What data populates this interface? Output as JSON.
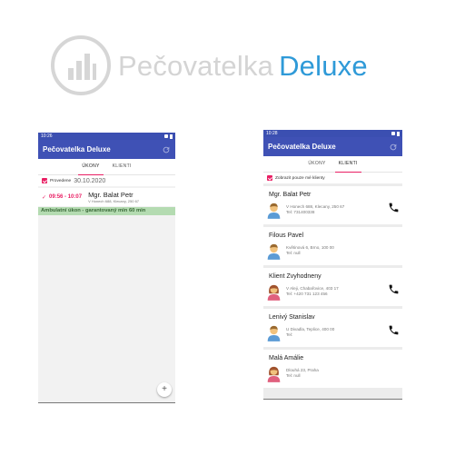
{
  "hero": {
    "brand": "Pečovatelka",
    "edition": "Deluxe",
    "colors": {
      "brand": "#d4d4d4",
      "edition": "#2f9ad8"
    }
  },
  "left_phone": {
    "status_time": "10:26",
    "app_title": "Pečovatelka Deluxe",
    "tabs": [
      "ÚKONY",
      "KLIENTI"
    ],
    "active_tab": "ÚKONY",
    "filter": {
      "label": "Provedene",
      "date": "30.10.2020",
      "checked": true
    },
    "visits": [
      {
        "time": "09:56 - 10:07",
        "client": "Mgr. Balat Petr",
        "address": "V Honech 688, Klecany, 250 67",
        "service": "Ambulatní úkon - garantovaný min 60 min"
      }
    ],
    "fab_label": "+"
  },
  "right_phone": {
    "status_time": "10:28",
    "app_title": "Pečovatelka Deluxe",
    "tabs": [
      "ÚKONY",
      "KLIENTI"
    ],
    "active_tab": "KLIENTI",
    "filter": {
      "label": "Zobrazit pouze mé klienty",
      "checked": true
    },
    "clients": [
      {
        "name": "Mgr. Balat Petr",
        "address": "V Honech 688, Klecany, 250 67",
        "phone": "Tel: 731400338",
        "gender": "male",
        "call": true
      },
      {
        "name": "Filous Pavel",
        "address": "Květinová 6, Brno, 100 00",
        "phone": "Tel: null",
        "gender": "male",
        "call": false
      },
      {
        "name": "Klient Zvyhodneny",
        "address": "V Aleji, Chabařovice, 403 17",
        "phone": "Tel: +420 731 123 456",
        "gender": "female",
        "call": true
      },
      {
        "name": "Lenivý Stanislav",
        "address": "U Divadla, Teplice, 400 00",
        "phone": "Tel:",
        "gender": "male",
        "call": true
      },
      {
        "name": "Malá Amálie",
        "address": "Dlouhá 23, Praha",
        "phone": "Tel: null",
        "gender": "female",
        "call": false
      }
    ]
  },
  "colors": {
    "primary": "#3f51b5",
    "status_bar": "#3b4fb1",
    "accent": "#e91e63",
    "service_bar": "#b4dbb1"
  }
}
